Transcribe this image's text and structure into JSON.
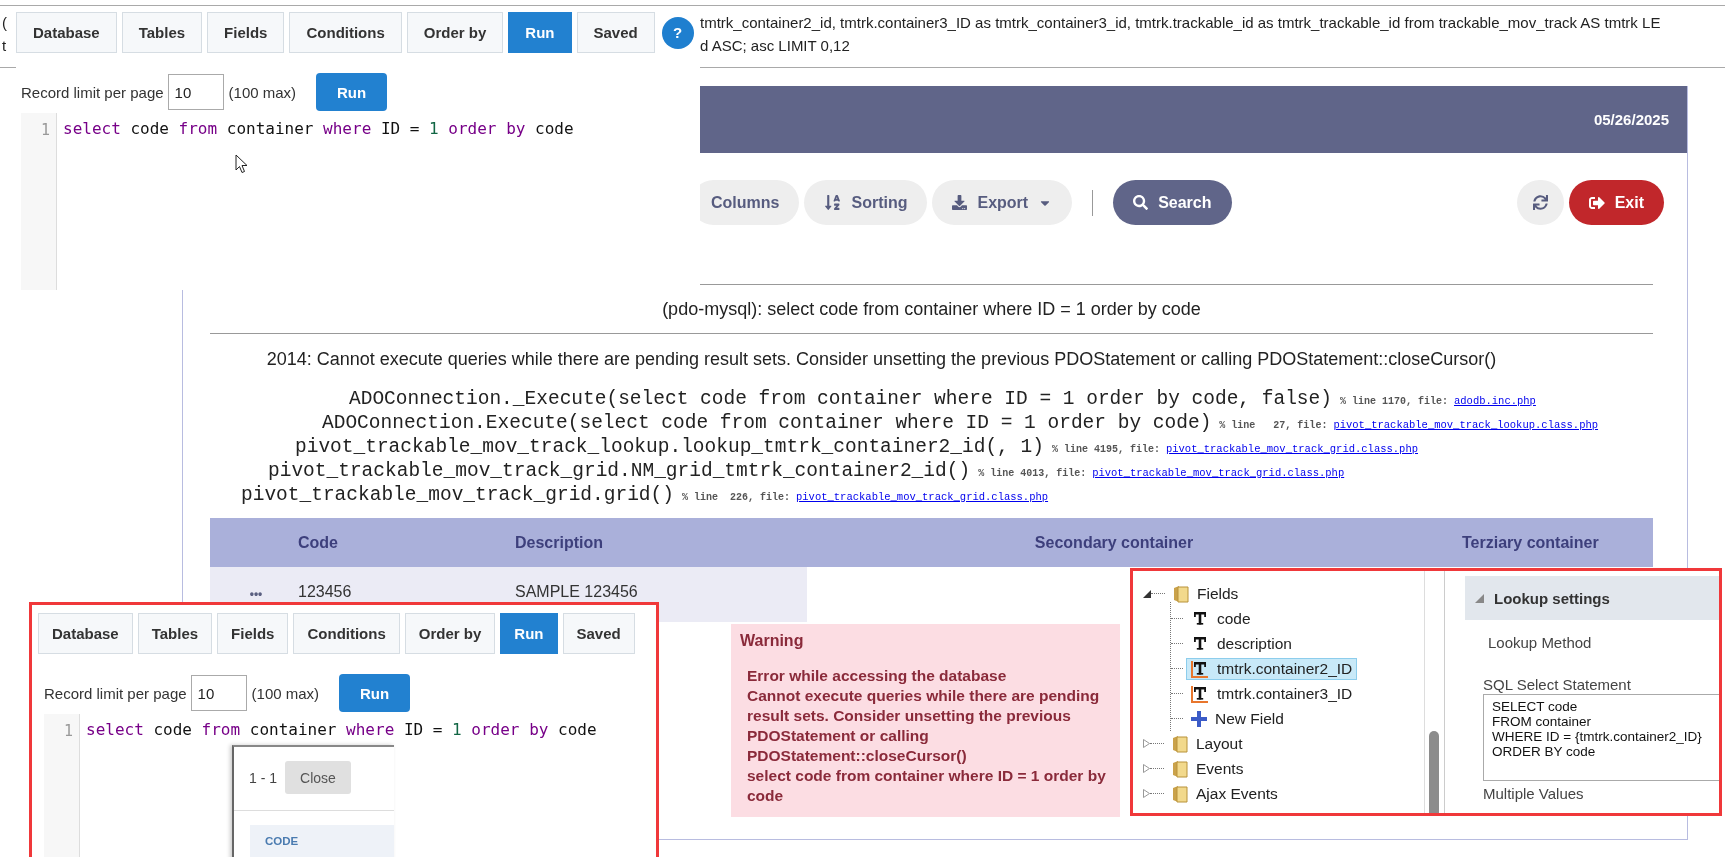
{
  "query_text": {
    "left_fragments": [
      "(",
      "t"
    ],
    "lines": [
      "tmtrk_container2_id, tmtrk.container3_ID as tmtrk_container3_id, tmtrk.trackable_id as tmtrk_trackable_id from trackable_mov_track AS tmtrk LE",
      "d ASC; asc LIMIT 0,12"
    ]
  },
  "query_builder": {
    "tabs": [
      {
        "label": "Database",
        "selected": false
      },
      {
        "label": "Tables",
        "selected": false
      },
      {
        "label": "Fields",
        "selected": false
      },
      {
        "label": "Conditions",
        "selected": false
      },
      {
        "label": "Order by",
        "selected": false
      },
      {
        "label": "Run",
        "selected": true
      },
      {
        "label": "Saved",
        "selected": false
      }
    ],
    "help": "?",
    "limit_label": "Record limit per page",
    "limit_value": "10",
    "limit_hint": "(100 max)",
    "run": "Run",
    "line_number": "1",
    "tokens": [
      {
        "text": "select",
        "kind": "keyword"
      },
      {
        "text": " code ",
        "kind": "plain"
      },
      {
        "text": "from",
        "kind": "keyword"
      },
      {
        "text": " container ",
        "kind": "plain"
      },
      {
        "text": "where",
        "kind": "keyword"
      },
      {
        "text": " ID = ",
        "kind": "plain"
      },
      {
        "text": "1",
        "kind": "number"
      },
      {
        "text": " order by",
        "kind": "keyword"
      },
      {
        "text": " code",
        "kind": "plain"
      }
    ]
  },
  "app": {
    "date": "05/26/2025",
    "toolbar": [
      {
        "label": "Columns",
        "kind": "plain"
      },
      {
        "label": "Sorting",
        "kind": "sort"
      },
      {
        "label": "Export",
        "kind": "export"
      }
    ],
    "search": "Search",
    "exit": "Exit",
    "connection": "(pdo-mysql): select code from container where ID = 1 order by code",
    "message": "2014: Cannot execute queries while there are pending result sets. Consider unsetting the previous PDOStatement or calling PDOStatement::closeCursor()",
    "trace": [
      {
        "call": "ADOConnection._Execute(select code from container where ID = 1 order by code, false)",
        "meta": "% line 1170, file:",
        "file": "adodb.inc.php"
      },
      {
        "call": "ADOConnection.Execute(select code from container where ID = 1 order by code)",
        "meta": "% line   27, file:",
        "file": "pivot_trackable_mov_track_lookup.class.php"
      },
      {
        "call": "pivot_trackable_mov_track_lookup.lookup_tmtrk_container2_id(, 1)",
        "meta": "% line 4195, file:",
        "file": "pivot_trackable_mov_track_grid.class.php"
      },
      {
        "call": "pivot_trackable_mov_track_grid.NM_grid_tmtrk_container2_id()",
        "meta": "% line 4013, file:",
        "file": "pivot_trackable_mov_track_grid.class.php"
      },
      {
        "call": "pivot_trackable_mov_track_grid.grid()",
        "meta": "% line  226, file:",
        "file": "pivot_trackable_mov_track_grid.class.php"
      }
    ],
    "table": {
      "columns": [
        "Code",
        "Description",
        "Secondary container",
        "Terziary container"
      ],
      "rows": [
        {
          "menu": "•••",
          "cells": [
            "123456",
            "SAMPLE 123456"
          ]
        }
      ]
    }
  },
  "warning": {
    "title": "Warning",
    "lines": [
      "Error while accessing the database",
      "Cannot execute queries while there are pending result sets. Consider unsetting the previous PDOStatement or calling PDOStatement::closeCursor()",
      "select code from container where ID = 1 order by code"
    ]
  },
  "field_tree": [
    {
      "label": "Fields",
      "kind": "folder",
      "expanded": true,
      "selected": false,
      "children": [
        {
          "label": "code",
          "kind": "text",
          "selected": false
        },
        {
          "label": "description",
          "kind": "text",
          "selected": false
        },
        {
          "label": "tmtrk.container2_ID",
          "kind": "lookup",
          "selected": true
        },
        {
          "label": "tmtrk.container3_ID",
          "kind": "lookup",
          "selected": false
        },
        {
          "label": "New Field",
          "kind": "add",
          "selected": false
        }
      ]
    },
    {
      "label": "Layout",
      "kind": "folder",
      "expanded": false,
      "selected": false
    },
    {
      "label": "Events",
      "kind": "folder",
      "expanded": false,
      "selected": false
    },
    {
      "label": "Ajax Events",
      "kind": "folder",
      "expanded": false,
      "selected": false
    }
  ],
  "lookup_settings": {
    "title": "Lookup settings",
    "method_label": "Lookup Method",
    "sql_label": "SQL Select Statement",
    "sql": "SELECT code\nFROM container\nWHERE ID = {tmtrk.container2_ID}\nORDER BY code",
    "multiple_label": "Multiple Values"
  },
  "query_builder_2": {
    "tabs": [
      {
        "label": "Database",
        "selected": false
      },
      {
        "label": "Tables",
        "selected": false
      },
      {
        "label": "Fields",
        "selected": false
      },
      {
        "label": "Conditions",
        "selected": false
      },
      {
        "label": "Order by",
        "selected": false
      },
      {
        "label": "Run",
        "selected": true
      },
      {
        "label": "Saved",
        "selected": false
      }
    ],
    "limit_label": "Record limit per page",
    "limit_value": "10",
    "limit_hint": "(100 max)",
    "run": "Run",
    "line_number": "1",
    "tokens": [
      {
        "text": "select",
        "kind": "keyword"
      },
      {
        "text": " code ",
        "kind": "plain"
      },
      {
        "text": "from",
        "kind": "keyword"
      },
      {
        "text": " container ",
        "kind": "plain"
      },
      {
        "text": "where",
        "kind": "keyword"
      },
      {
        "text": " ID = ",
        "kind": "plain"
      },
      {
        "text": "1",
        "kind": "number"
      },
      {
        "text": " order by",
        "kind": "keyword"
      },
      {
        "text": " code",
        "kind": "plain"
      }
    ],
    "result_dialog": {
      "count": "1 - 1",
      "close": "Close",
      "column": "CODE"
    }
  }
}
